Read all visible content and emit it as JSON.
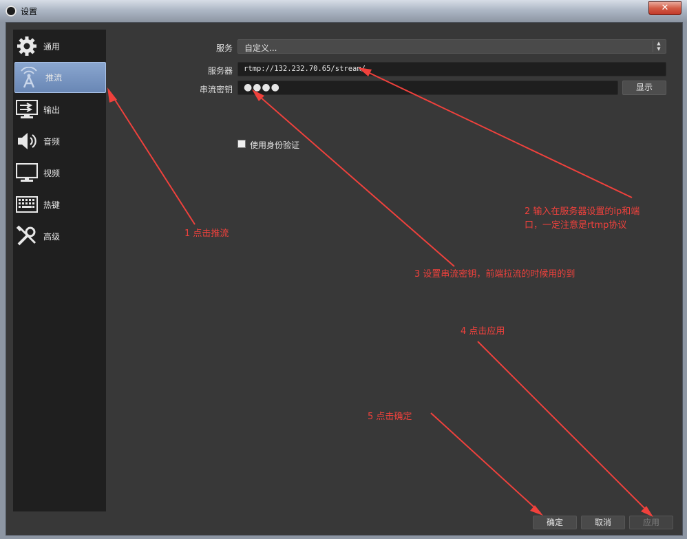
{
  "window": {
    "title": "设置",
    "close_glyph": "✕"
  },
  "sidebar": {
    "items": [
      {
        "label": "通用",
        "icon": "gear-icon"
      },
      {
        "label": "推流",
        "icon": "broadcast-icon",
        "active": true
      },
      {
        "label": "输出",
        "icon": "output-icon"
      },
      {
        "label": "音频",
        "icon": "speaker-icon"
      },
      {
        "label": "视频",
        "icon": "monitor-icon"
      },
      {
        "label": "热键",
        "icon": "keyboard-icon"
      },
      {
        "label": "高级",
        "icon": "tools-icon"
      }
    ]
  },
  "form": {
    "service_label": "服务",
    "service_value": "自定义...",
    "server_label": "服务器",
    "server_value": "rtmp://132.232.70.65/stream/",
    "key_label": "串流密钥",
    "key_value": "●●●●",
    "show_button": "显示",
    "auth_label": "使用身份验证"
  },
  "buttons": {
    "ok": "确定",
    "cancel": "取消",
    "apply": "应用"
  },
  "annotations": {
    "a1": "1 点击推流",
    "a2_line1": "2 输入在服务器设置的ip和端",
    "a2_line2": "口，一定注意是rtmp协议",
    "a3": "3 设置串流密钥，前端拉流的时候用的到",
    "a4": "4 点击应用",
    "a5": "5 点击确定"
  },
  "colors": {
    "annotation": "#f0413c",
    "active_nav": "#7494c2",
    "background": "#383838",
    "sidebar": "#1f1f1f"
  }
}
